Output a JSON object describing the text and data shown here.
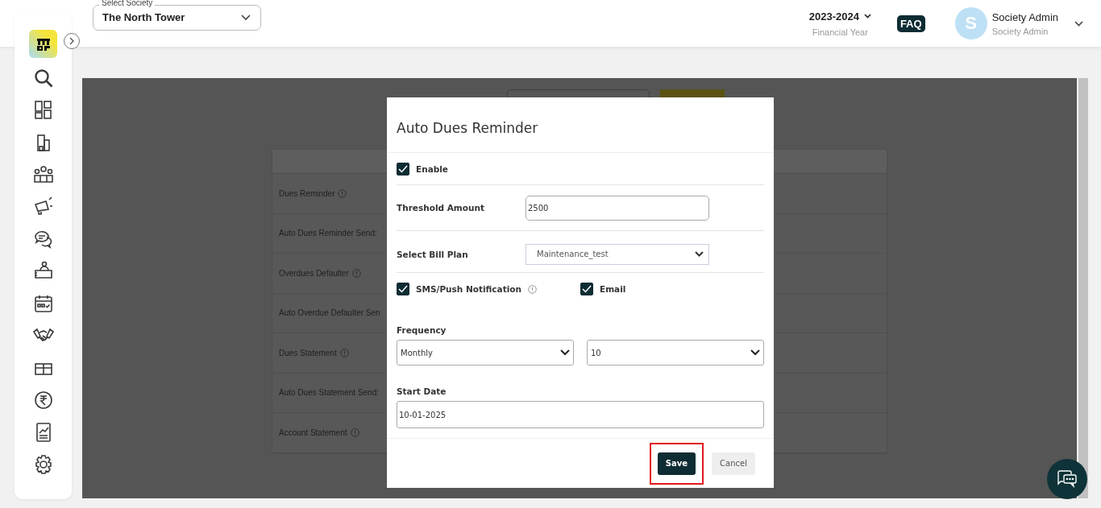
{
  "header": {
    "society_select": {
      "label": "Select Society",
      "value": "The North Tower"
    },
    "financial_year": {
      "value": "2023-2024",
      "label": "Financial Year"
    },
    "faq": "FAQ",
    "user": {
      "initial": "S",
      "name": "Society Admin",
      "role": "Society Admin"
    }
  },
  "background": {
    "rows": [
      {
        "label": "Dues Reminder",
        "info": true
      },
      {
        "label": "Auto Dues Reminder Send:",
        "info": false
      },
      {
        "label": "Overdues Defaulter",
        "info": true
      },
      {
        "label": "Auto Overdue Defaulter Sen",
        "info": false
      },
      {
        "label": "Dues Statement",
        "info": true
      },
      {
        "label": "Auto Dues Statement Send:",
        "info": false
      },
      {
        "label": "Account Statement",
        "info": true
      }
    ]
  },
  "modal": {
    "title": "Auto Dues Reminder",
    "enable": {
      "label": "Enable",
      "checked": true
    },
    "threshold": {
      "label": "Threshold Amount",
      "value": "2500"
    },
    "bill_plan": {
      "label": "Select Bill Plan",
      "value": "Maintenance_test"
    },
    "channels": [
      {
        "label": "SMS/Push Notification",
        "checked": true,
        "info": true
      },
      {
        "label": "Email",
        "checked": true,
        "info": false
      }
    ],
    "frequency": {
      "label": "Frequency",
      "period": "Monthly",
      "day": "10"
    },
    "start_date": {
      "label": "Start Date",
      "value": "10-01-2025"
    },
    "buttons": [
      {
        "label": "Save",
        "kind": "primary",
        "highlighted": true
      },
      {
        "label": "Cancel",
        "kind": "secondary",
        "highlighted": false
      }
    ]
  }
}
